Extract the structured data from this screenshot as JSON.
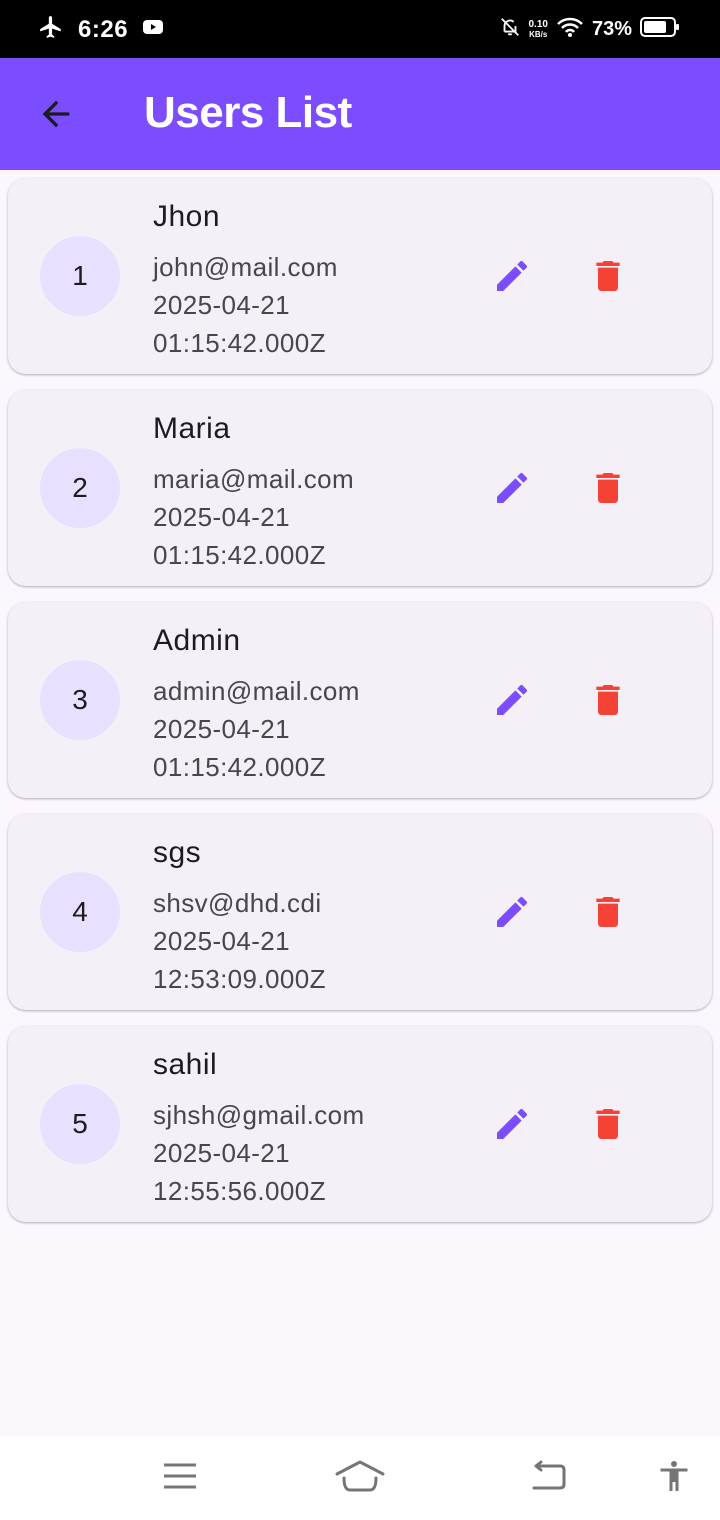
{
  "status_bar": {
    "time": "6:26",
    "net_speed_value": "0.10",
    "net_speed_unit": "KB/s",
    "battery": "73%",
    "icons": [
      "airplane-icon",
      "youtube-icon",
      "mute-icon",
      "wifi-icon",
      "battery-icon"
    ]
  },
  "app_bar": {
    "title": "Users List",
    "back_icon": "arrow-back-icon",
    "color": "#7c4dff"
  },
  "users": [
    {
      "id": "1",
      "name": "Jhon",
      "email": "john@mail.com",
      "date": "2025-04-21",
      "time": "01:15:42.000Z"
    },
    {
      "id": "2",
      "name": "Maria",
      "email": "maria@mail.com",
      "date": "2025-04-21",
      "time": "01:15:42.000Z"
    },
    {
      "id": "3",
      "name": "Admin",
      "email": "admin@mail.com",
      "date": "2025-04-21",
      "time": "01:15:42.000Z"
    },
    {
      "id": "4",
      "name": "sgs",
      "email": "shsv@dhd.cdi",
      "date": "2025-04-21",
      "time": "12:53:09.000Z"
    },
    {
      "id": "5",
      "name": "sahil",
      "email": "sjhsh@gmail.com",
      "date": "2025-04-21",
      "time": "12:55:56.000Z"
    }
  ],
  "actions": {
    "edit_icon": "pencil-icon",
    "edit_color": "#7c4dff",
    "delete_icon": "trash-icon",
    "delete_color": "#f44336"
  },
  "nav_bar": {
    "icons": [
      "menu-icon",
      "home-icon",
      "back-icon",
      "accessibility-icon"
    ]
  }
}
